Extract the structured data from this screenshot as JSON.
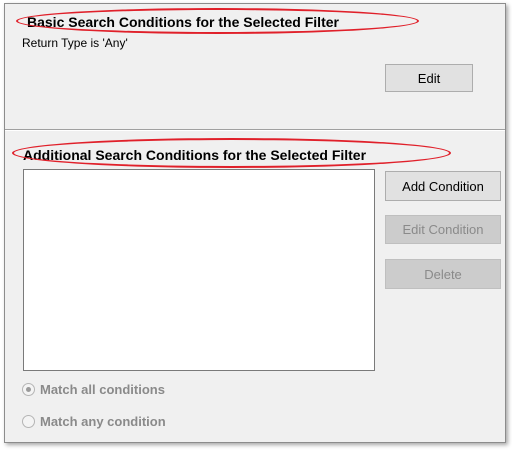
{
  "basic_section": {
    "title": "Basic Search Conditions for the Selected Filter",
    "return_type_text": "Return Type is 'Any'",
    "edit_label": "Edit"
  },
  "additional_section": {
    "title": "Additional Search Conditions for the Selected Filter",
    "add_condition_label": "Add Condition",
    "edit_condition_label": "Edit Condition",
    "delete_label": "Delete",
    "conditions_list": []
  },
  "match_options": {
    "all_label": "Match all conditions",
    "any_label": "Match any condition",
    "selected": "all",
    "enabled": false
  },
  "colors": {
    "highlight": "#e0202a",
    "panel_background": "#f0f0f0"
  }
}
